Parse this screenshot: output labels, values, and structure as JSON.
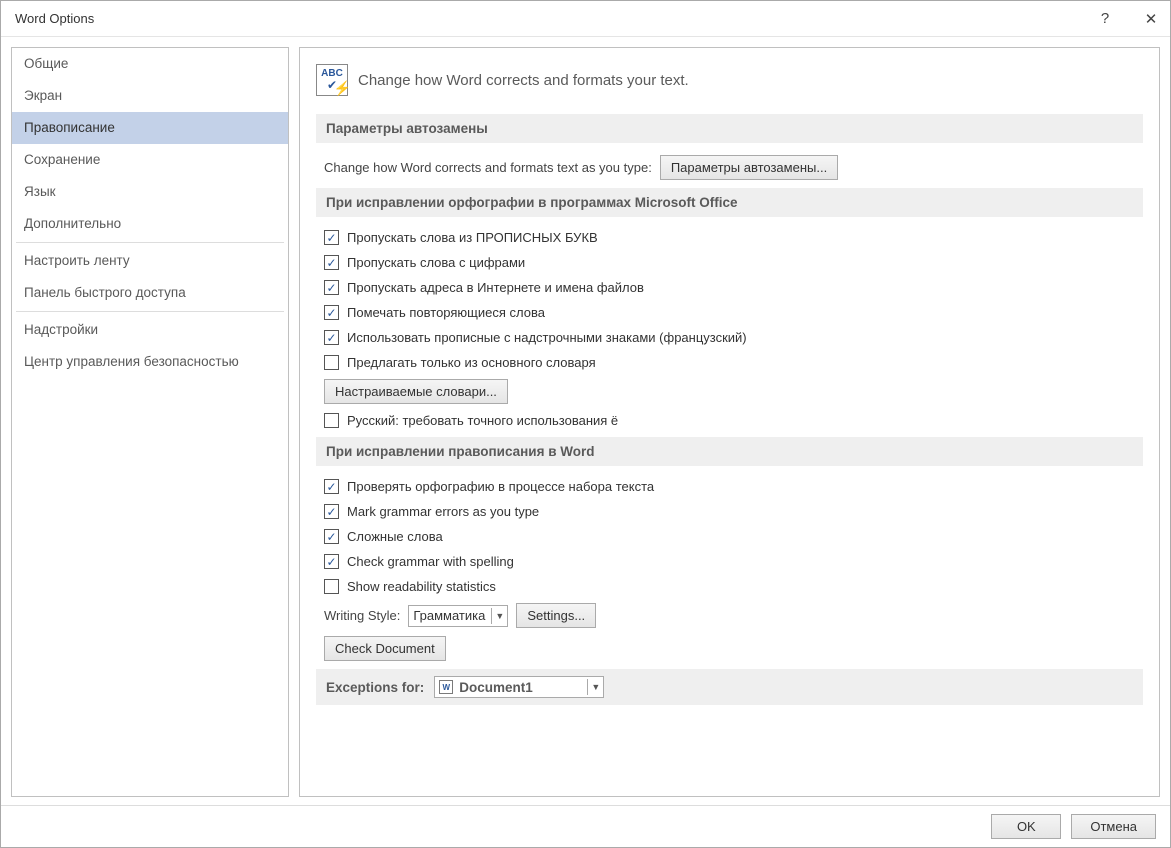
{
  "window": {
    "title": "Word Options",
    "help_tooltip": "?",
    "close_tooltip": "✕"
  },
  "sidebar": {
    "items": [
      {
        "label": "Общие"
      },
      {
        "label": "Экран"
      },
      {
        "label": "Правописание",
        "selected": true
      },
      {
        "label": "Сохранение"
      },
      {
        "label": "Язык"
      },
      {
        "label": "Дополнительно"
      },
      {
        "label": "Настроить ленту"
      },
      {
        "label": "Панель быстрого доступа"
      },
      {
        "label": "Надстройки"
      },
      {
        "label": "Центр управления безопасностью"
      }
    ]
  },
  "header": {
    "text": "Change how Word corrects and formats your text."
  },
  "section_autocorrect": {
    "title": "Параметры автозамены",
    "descr": "Change how Word corrects and formats text as you type:",
    "button": "Параметры автозамены..."
  },
  "section_spell_office": {
    "title": "При исправлении орфографии в программах Microsoft Office",
    "checks": [
      {
        "label": "Пропускать слова из ПРОПИСНЫХ БУКВ",
        "checked": true
      },
      {
        "label": "Пропускать слова с цифрами",
        "checked": true
      },
      {
        "label": "Пропускать адреса в Интернете и имена файлов",
        "checked": true
      },
      {
        "label": "Помечать повторяющиеся слова",
        "checked": true
      },
      {
        "label": "Использовать прописные с надстрочными знаками (французский)",
        "checked": true
      },
      {
        "label": "Предлагать только из основного словаря",
        "checked": false
      }
    ],
    "dict_button": "Настраиваемые словари...",
    "russian_e": {
      "label": "Русский: требовать точного использования ё",
      "checked": false
    }
  },
  "section_spell_word": {
    "title": "При исправлении правописания в Word",
    "checks": [
      {
        "label": "Проверять орфографию в процессе набора текста",
        "checked": true
      },
      {
        "label": "Mark grammar errors as you type",
        "checked": true
      },
      {
        "label": "Сложные слова",
        "checked": true
      },
      {
        "label": "Check grammar with spelling",
        "checked": true
      },
      {
        "label": "Show readability statistics",
        "checked": false
      }
    ],
    "writing_style_label": "Writing Style:",
    "writing_style_value": "Грамматика",
    "settings_button": "Settings...",
    "check_doc_button": "Check Document"
  },
  "section_exceptions": {
    "title_prefix": "Exceptions for:",
    "doc_value": "Document1"
  },
  "footer": {
    "ok": "OK",
    "cancel": "Отмена"
  }
}
